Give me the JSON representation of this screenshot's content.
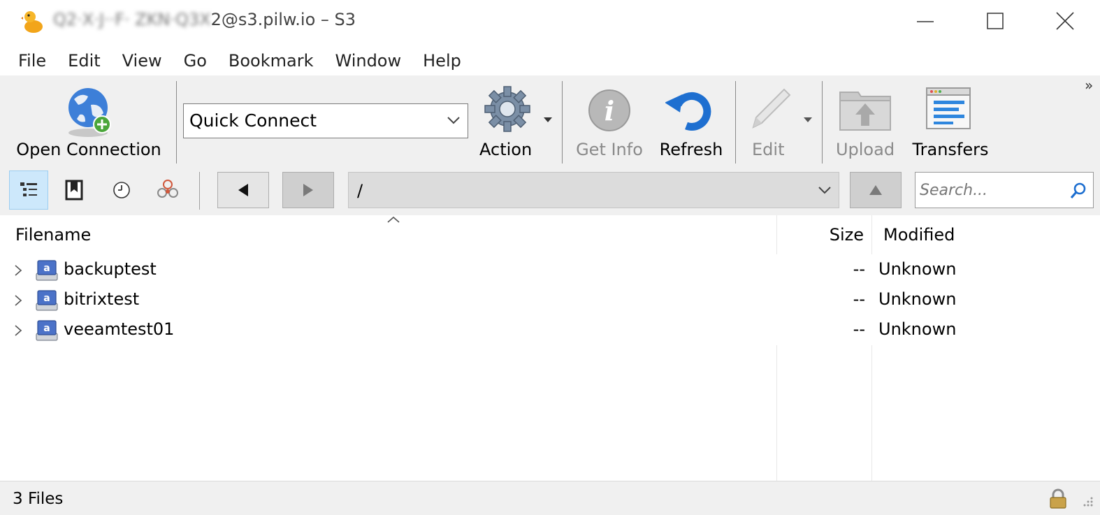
{
  "window": {
    "title_obscured": "Q2·X·J··F· ZKN·Q3X",
    "title_visible": "2@s3.pilw.io – S3"
  },
  "menu": [
    "File",
    "Edit",
    "View",
    "Go",
    "Bookmark",
    "Window",
    "Help"
  ],
  "toolbar": {
    "open_connection": "Open Connection",
    "quick_connect": "Quick Connect",
    "action": "Action",
    "get_info": "Get Info",
    "refresh": "Refresh",
    "edit": "Edit",
    "upload": "Upload",
    "transfers": "Transfers",
    "overflow": "»"
  },
  "navigation": {
    "path": "/",
    "search_placeholder": "Search..."
  },
  "columns": {
    "filename": "Filename",
    "size": "Size",
    "modified": "Modified"
  },
  "files": [
    {
      "name": "backuptest",
      "size": "--",
      "modified": "Unknown"
    },
    {
      "name": "bitrixtest",
      "size": "--",
      "modified": "Unknown"
    },
    {
      "name": "veeamtest01",
      "size": "--",
      "modified": "Unknown"
    }
  ],
  "status": {
    "text": "3 Files"
  },
  "colors": {
    "toolbar_bg": "#f0f0f0",
    "selected_view_bg": "#cde8fb",
    "path_bg": "#dcdcdc",
    "accent_blue": "#1e6fd0"
  },
  "icons": [
    "duck-app-icon",
    "globe-plus-icon",
    "gear-icon",
    "info-icon",
    "refresh-icon",
    "pencil-icon",
    "upload-icon",
    "transfers-icon",
    "outline-view-icon",
    "bookmark-icon",
    "history-icon",
    "bonjour-icon",
    "back-icon",
    "forward-icon",
    "parent-dir-icon",
    "search-icon",
    "bucket-icon",
    "lock-icon"
  ]
}
